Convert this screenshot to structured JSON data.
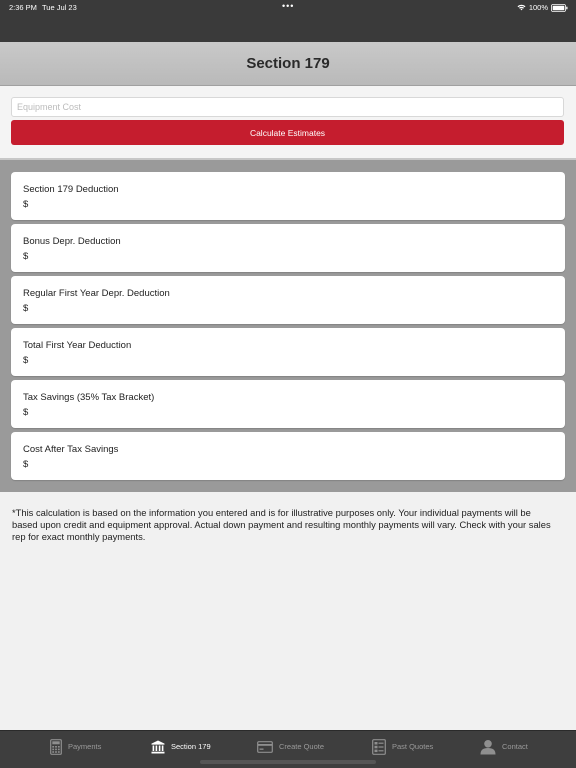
{
  "status_bar": {
    "time": "2:36 PM",
    "date": "Tue Jul 23",
    "battery": "100%"
  },
  "header": {
    "title": "Section 179"
  },
  "form": {
    "equipment_cost_placeholder": "Equipment Cost",
    "calculate_label": "Calculate Estimates"
  },
  "results": [
    {
      "label": "Section 179 Deduction",
      "value": "$"
    },
    {
      "label": "Bonus Depr. Deduction",
      "value": "$"
    },
    {
      "label": "Regular First Year Depr. Deduction",
      "value": "$"
    },
    {
      "label": "Total First Year Deduction",
      "value": "$"
    },
    {
      "label": "Tax Savings (35% Tax Bracket)",
      "value": "$"
    },
    {
      "label": "Cost After Tax Savings",
      "value": "$"
    }
  ],
  "disclaimer": "*This calculation is based on the information you entered and is for illustrative purposes only. Your individual payments will be based upon credit and equipment approval. Actual down payment and resulting monthly payments will vary. Check with your sales rep for exact monthly payments.",
  "tabs": [
    {
      "label": "Payments",
      "icon": "calculator-icon",
      "active": false
    },
    {
      "label": "Section 179",
      "icon": "bank-icon",
      "active": true
    },
    {
      "label": "Create Quote",
      "icon": "credit-card-icon",
      "active": false
    },
    {
      "label": "Past Quotes",
      "icon": "list-document-icon",
      "active": false
    },
    {
      "label": "Contact",
      "icon": "person-icon",
      "active": false
    }
  ],
  "colors": {
    "accent": "#c51d2e",
    "tab_bar": "#3e3e3e",
    "results_background": "#9a9a9a"
  }
}
